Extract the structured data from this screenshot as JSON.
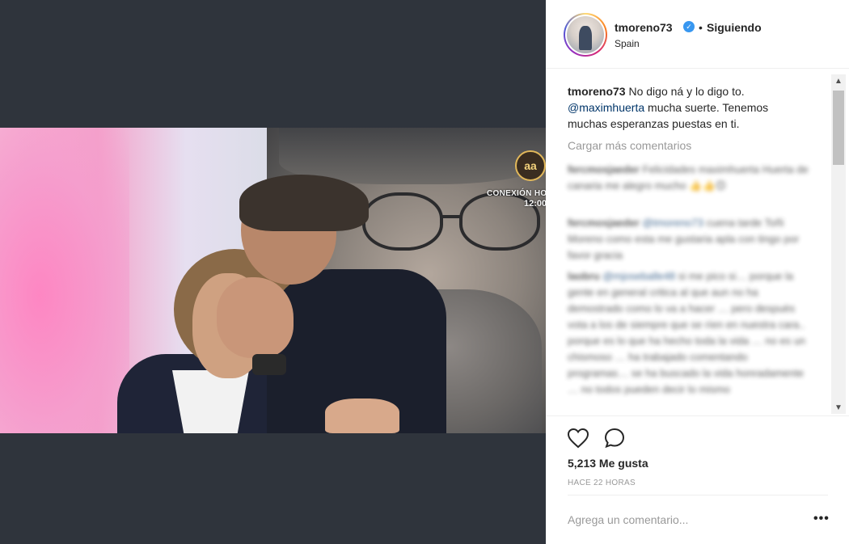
{
  "post": {
    "username": "tmoreno73",
    "separator": "•",
    "follow_state": "Siguiendo",
    "location": "Spain",
    "verified_icon": "verified-badge-icon"
  },
  "video": {
    "logo_mark": "aa",
    "logo_text": "CONEXIÓN HO",
    "logo_time": "12:00"
  },
  "caption": {
    "username": "tmoreno73",
    "text_1": "No digo ná y lo digo to.",
    "mention": "@maximhuerta",
    "text_2": "mucha suerte. Tenemos muchas esperanzas puestas en ti."
  },
  "comments": {
    "load_more": "Cargar más comentarios",
    "items": [
      {
        "user": "fercmosjaeder",
        "mention": "",
        "text": "Felicidades maximhuerta Huerta de canaria me alegro mucho 👍👍😊"
      },
      {
        "user": "fercmosjaeder",
        "mention": "@tmoreno73",
        "text": "cuena tarde Toñi Moreno como esta me gustaria apla con tingo por favor gracia"
      },
      {
        "user": "laobru",
        "mention": "@mjoseballe48",
        "text": "si me pico si… porque la gente en general critica al que aun no ha demostrado como lo va a hacer … pero despuès vota a los de siempre que se ríen en nuestra cara.. porque es lo que ha hecho toda la vida … no es un chismoso … ha trabajado comentando programas… se ha buscado la vida honradamente … no todos pueden decir lo mismo"
      }
    ]
  },
  "scrollbar": {
    "up": "▲",
    "down": "▼"
  },
  "actions": {
    "like_icon": "heart-icon",
    "comment_icon": "comment-icon",
    "likes": "5,213 Me gusta",
    "time": "HACE 22 HORAS",
    "add_comment_placeholder": "Agrega un comentario...",
    "more": "•••"
  },
  "colors": {
    "media_background": "#2f343c",
    "link": "#003569",
    "muted": "#999999",
    "verified": "#3897f0"
  }
}
